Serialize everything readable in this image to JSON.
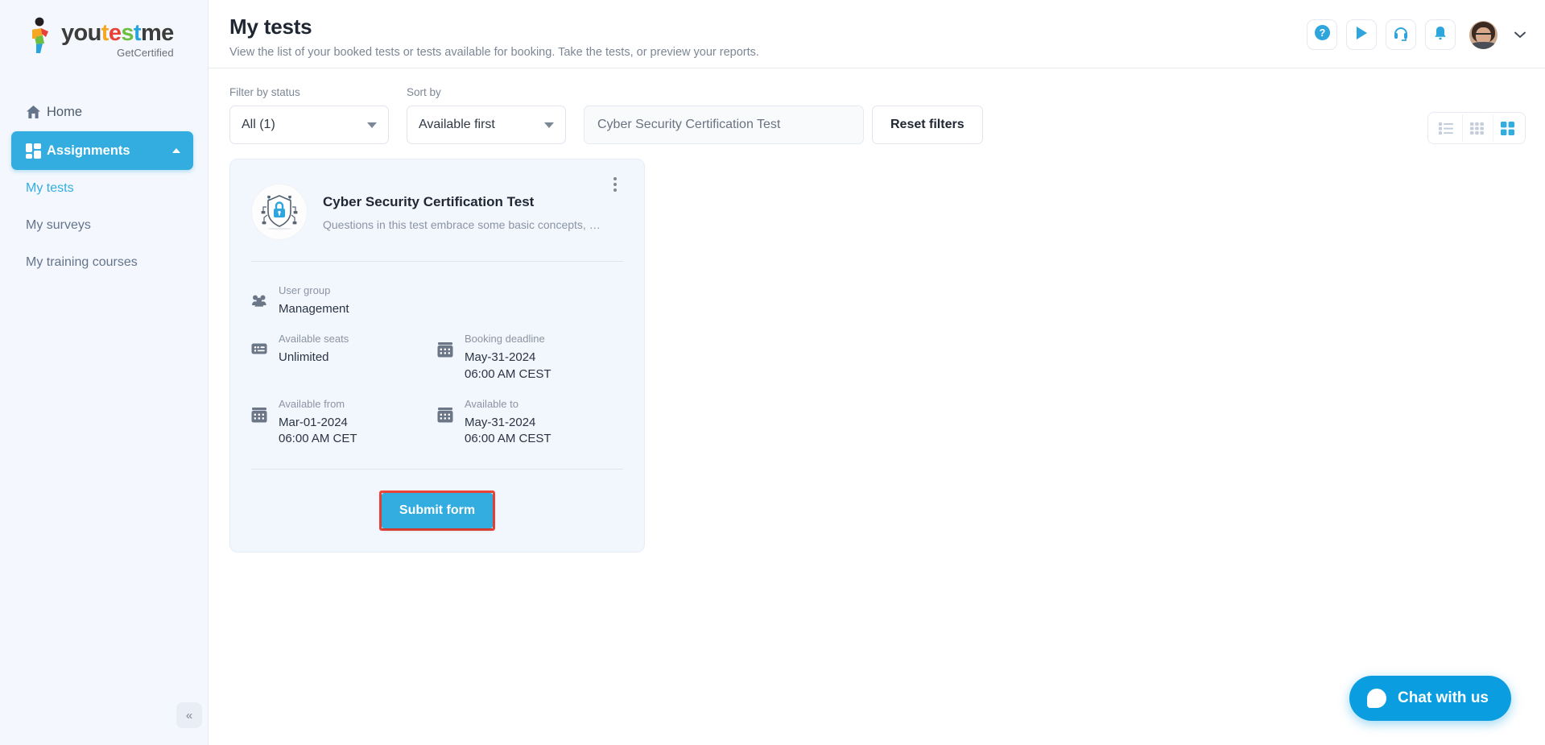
{
  "brand": {
    "name_parts": [
      {
        "text": "you",
        "color": "#3c3c3b"
      },
      {
        "text": "t",
        "color": "#f5a623"
      },
      {
        "text": "e",
        "color": "#e8413a"
      },
      {
        "text": "s",
        "color": "#6fbe44"
      },
      {
        "text": "t",
        "color": "#29a3dc"
      },
      {
        "text": "me",
        "color": "#3c3c3b"
      }
    ],
    "tagline": "GetCertified"
  },
  "sidebar": {
    "items": [
      {
        "label": "Home",
        "icon": "home-icon",
        "active": false
      },
      {
        "label": "Assignments",
        "icon": "grid-icon",
        "active": true
      }
    ],
    "sub_items": [
      {
        "label": "My tests",
        "selected": true
      },
      {
        "label": "My surveys",
        "selected": false
      },
      {
        "label": "My training courses",
        "selected": false
      }
    ],
    "collapse_icon": "chevron-double-left-icon"
  },
  "header": {
    "title": "My tests",
    "subtitle": "View the list of your booked tests or tests available for booking. Take the tests, or preview your reports.",
    "icons": [
      {
        "name": "help-icon",
        "glyph": "?"
      },
      {
        "name": "play-icon",
        "glyph": "▶"
      },
      {
        "name": "support-headset-icon",
        "glyph": "headset"
      },
      {
        "name": "notifications-bell-icon",
        "glyph": "bell"
      }
    ],
    "profile_chevron": "⌄"
  },
  "filters": {
    "status_label": "Filter by status",
    "status_value": "All (1)",
    "sort_label": "Sort by",
    "sort_value": "Available first",
    "search_value": "Cyber Security Certification Test",
    "search_placeholder": "Search",
    "reset_label": "Reset filters",
    "views": [
      {
        "name": "list-view-toggle",
        "active": false
      },
      {
        "name": "compact-grid-view-toggle",
        "active": false
      },
      {
        "name": "card-grid-view-toggle",
        "active": true
      }
    ]
  },
  "test_card": {
    "thumb_icon": "shield-lock-icon",
    "title": "Cyber Security Certification Test",
    "description": "Questions in this test embrace some basic concepts, …",
    "menu_icon": "kebab-menu-icon",
    "info": [
      [
        {
          "icon": "user-group-icon",
          "label": "User group",
          "value": "Management"
        }
      ],
      [
        {
          "icon": "seats-icon",
          "label": "Available seats",
          "value": "Unlimited"
        },
        {
          "icon": "calendar-icon",
          "label": "Booking deadline",
          "value": "May-31-2024\n06:00 AM CEST"
        }
      ],
      [
        {
          "icon": "calendar-icon",
          "label": "Available from",
          "value": "Mar-01-2024\n06:00 AM CET"
        },
        {
          "icon": "calendar-icon",
          "label": "Available to",
          "value": "May-31-2024\n06:00 AM CEST"
        }
      ]
    ],
    "submit_label": "Submit form",
    "submit_highlighted": true
  },
  "chat": {
    "label": "Chat with us",
    "icon": "chat-bubble-icon"
  },
  "colors": {
    "accent": "#33ade0",
    "chat": "#0a9ddf",
    "highlight": "#ee4337",
    "card_bg": "#f2f6fd",
    "sidebar_bg": "#f4f7fd"
  }
}
